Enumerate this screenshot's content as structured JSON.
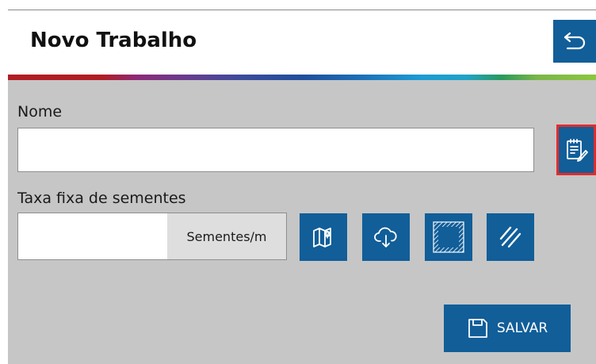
{
  "header": {
    "title": "Novo Trabalho",
    "back_icon": "return-arrow-icon"
  },
  "form": {
    "name_label": "Nome",
    "name_value": "",
    "edit_icon": "notepad-edit-icon",
    "rate_label": "Taxa fixa de sementes",
    "rate_value": "",
    "rate_unit": "Sementes/m"
  },
  "tools": [
    {
      "icon": "map-pin-icon"
    },
    {
      "icon": "cloud-download-icon"
    },
    {
      "icon": "boundary-fill-icon"
    },
    {
      "icon": "hatch-lines-icon"
    }
  ],
  "footer": {
    "save_label": "SALVAR",
    "save_icon": "floppy-disk-icon"
  },
  "colors": {
    "primary": "#115e99",
    "panel": "#c6c6c6",
    "highlight": "#e32b2b"
  }
}
